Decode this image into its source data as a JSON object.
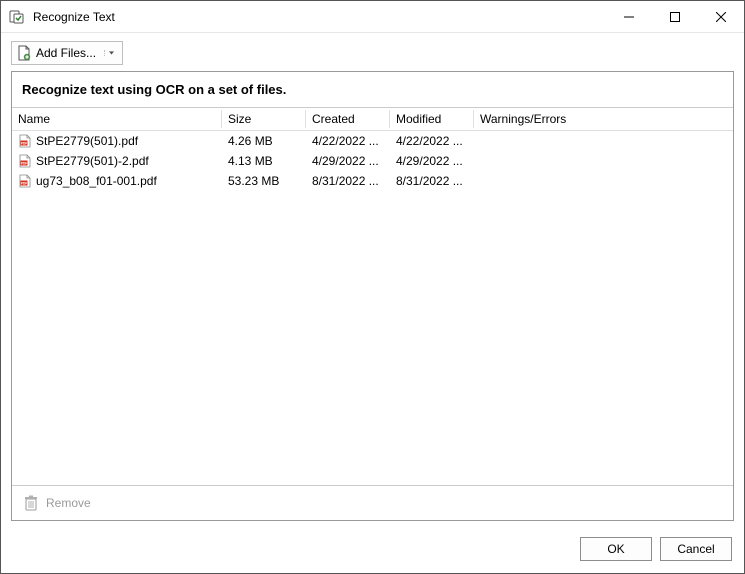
{
  "window": {
    "title": "Recognize Text"
  },
  "toolbar": {
    "add_files_label": "Add Files..."
  },
  "panel": {
    "heading": "Recognize text using OCR on a set of files."
  },
  "columns": {
    "name": "Name",
    "size": "Size",
    "created": "Created",
    "modified": "Modified",
    "warnings": "Warnings/Errors"
  },
  "files": [
    {
      "name": "StPE2779(501).pdf",
      "size": "4.26 MB",
      "created": "4/22/2022 ...",
      "modified": "4/22/2022 ...",
      "warnings": ""
    },
    {
      "name": "StPE2779(501)-2.pdf",
      "size": "4.13 MB",
      "created": "4/29/2022 ...",
      "modified": "4/29/2022 ...",
      "warnings": ""
    },
    {
      "name": "ug73_b08_f01-001.pdf",
      "size": "53.23 MB",
      "created": "8/31/2022 ...",
      "modified": "8/31/2022 ...",
      "warnings": ""
    }
  ],
  "remove": {
    "label": "Remove"
  },
  "buttons": {
    "ok": "OK",
    "cancel": "Cancel"
  }
}
